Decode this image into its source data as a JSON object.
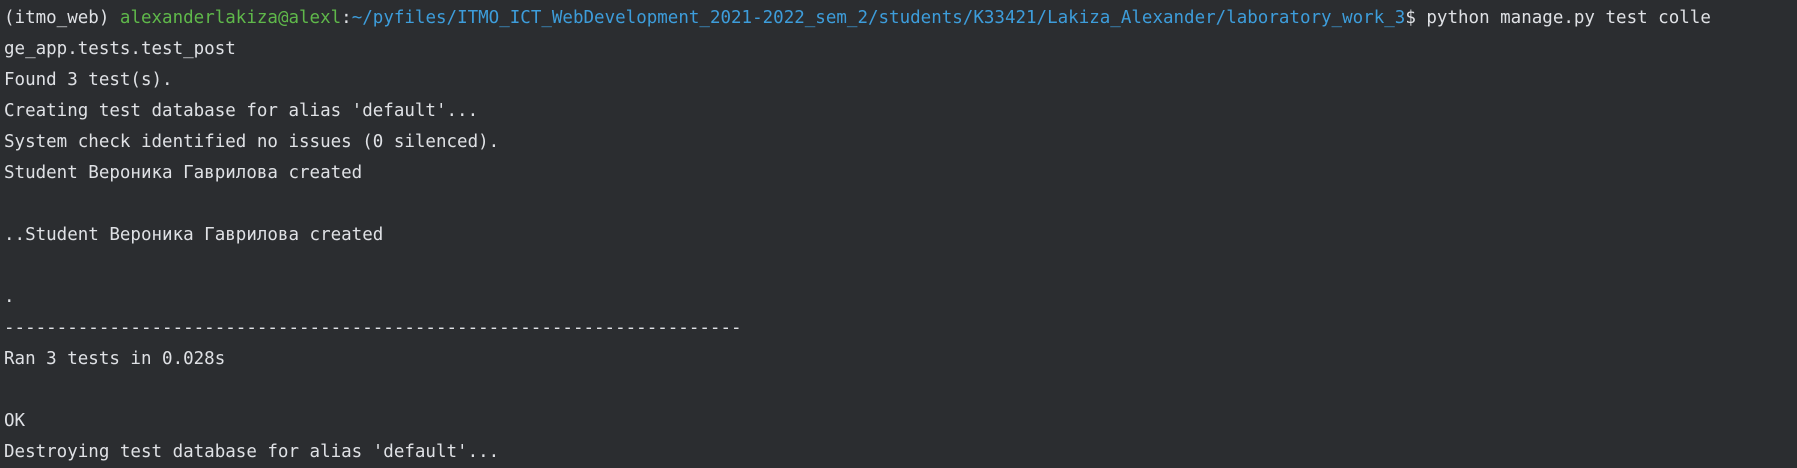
{
  "prompt": {
    "env": "(itmo_web) ",
    "user_host": "alexanderlakiza@alexl",
    "separator": ":",
    "path": "~/pyfiles/ITMO_ICT_WebDevelopment_2021-2022_sem_2/students/K33421/Lakiza_Alexander/laboratory_work_3",
    "dollar": "$ ",
    "command_part1": "python manage.py test colle"
  },
  "output_lines": [
    "ge_app.tests.test_post",
    "Found 3 test(s).",
    "Creating test database for alias 'default'...",
    "System check identified no issues (0 silenced).",
    "Student Вероника Гаврилова created",
    "",
    "..Student Вероника Гаврилова created",
    "",
    ".",
    "----------------------------------------------------------------------",
    "Ran 3 tests in 0.028s",
    "",
    "OK",
    "Destroying test database for alias 'default'..."
  ]
}
